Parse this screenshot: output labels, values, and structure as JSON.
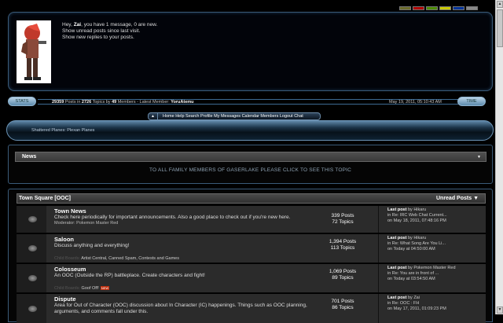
{
  "swatches": [
    "#6b6b2b",
    "#b00000",
    "#4a8a00",
    "#c8c800",
    "#003399",
    "#888888"
  ],
  "profile": {
    "greeting_prefix": "Hey, ",
    "username": "Zai",
    "greeting_suffix": ", you have 1 message, 0 are new.",
    "link1": "Show unread posts since last visit.",
    "link2": "Show new replies to your posts."
  },
  "stats": {
    "left_button": "STATS",
    "right_button": "TIME",
    "posts": "29359",
    "posts_label": " Posts in ",
    "topics": "2726",
    "topics_label": " Topics by ",
    "members": "49",
    "members_label": " Members - Latest Member: ",
    "latest": "YoruAtemu",
    "time": "May 19, 2011, 05:10:43 AM"
  },
  "nav": {
    "links": "Home Help Search Profile My Messages Calendar Members Logout Chat"
  },
  "breadcrumb": "Shattered Planes: Plexan Planes",
  "news": {
    "title": "News",
    "message": "TO ALL FAMILY MEMBERS OF GASERLAKE PLEASE CLICK TO SEE THIS TOPIC"
  },
  "category": {
    "title": "Town Square [OOC]",
    "unread": "Unread Posts"
  },
  "boards": [
    {
      "name": "Town News",
      "desc": "Check here periodically for important announcements. Also a good place to check out if you're new here.",
      "mod": "Moderator: Pokemon Master Red",
      "posts": "339 Posts",
      "topics": "72 Topics",
      "last_label": "Last post",
      "last_by": " by Hikaru",
      "last_in": "in Re: IRC Web Chat Current...",
      "last_on": "on May 18, 2011, 07:48:16 PM"
    },
    {
      "name": "Saloon",
      "desc": "Discuss anything and everything!",
      "mod": "",
      "posts": "1,394 Posts",
      "topics": "113 Topics",
      "last_label": "Last post",
      "last_by": " by Hikaru",
      "last_in": "in Re: What Song Are You Li...",
      "last_on": "on Today at 04:50:00 AM",
      "child_label": "Child Boards: ",
      "child_boards": "Artist Central, Canned Spam, Contests and Games"
    },
    {
      "name": "Colosseum",
      "desc": "An OOC (Outside the RP) battleplace. Create characters and fight!",
      "mod": "",
      "posts": "1,069 Posts",
      "topics": "89 Topics",
      "last_label": "Last post",
      "last_by": " by Pokemon Master Red",
      "last_in": "in Re: You are in front of ...",
      "last_on": "on Today at 03:54:50 AM",
      "child_label": "Child Boards: ",
      "child_boards": "Goof Off!",
      "child_new": "NEW"
    },
    {
      "name": "Dispute",
      "desc": "Area for Out of Character (OOC) discussion about In Character (IC) happenings. Things such as OOC planning, arguments, and comments fall under this.",
      "mod": "",
      "posts": "701 Posts",
      "topics": "86 Topics",
      "last_label": "Last post",
      "last_by": " by Zai",
      "last_in": "in Re: OOC : FH",
      "last_on": "on May 17, 2011, 01:09:23 PM"
    }
  ]
}
